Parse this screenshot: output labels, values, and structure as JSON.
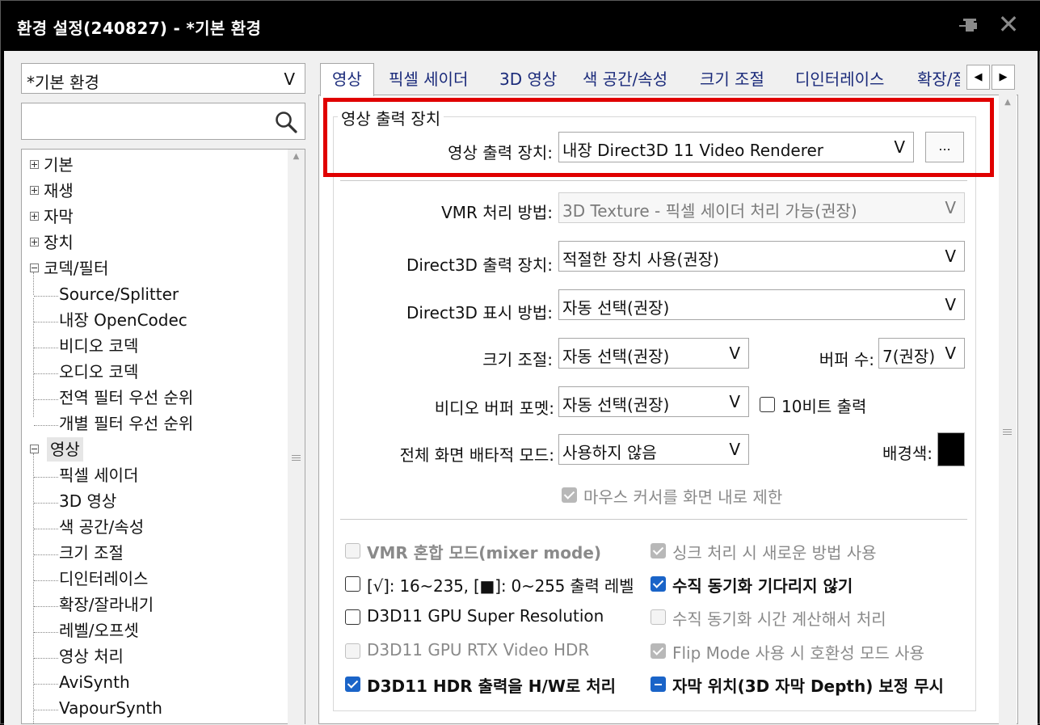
{
  "window": {
    "title": "환경 설정(240827) - *기본 환경",
    "close_glyph": "✕"
  },
  "profile": {
    "selected": "*기본 환경",
    "arrow": "V"
  },
  "search": {
    "value": ""
  },
  "tree": {
    "items": [
      {
        "label": "기본",
        "kind": "collapsed"
      },
      {
        "label": "재생",
        "kind": "collapsed"
      },
      {
        "label": "자막",
        "kind": "collapsed"
      },
      {
        "label": "장치",
        "kind": "collapsed"
      },
      {
        "label": "코덱/필터",
        "kind": "expanded"
      },
      {
        "label": "Source/Splitter",
        "kind": "child"
      },
      {
        "label": "내장 OpenCodec",
        "kind": "child"
      },
      {
        "label": "비디오 코덱",
        "kind": "child"
      },
      {
        "label": "오디오 코덱",
        "kind": "child"
      },
      {
        "label": "전역 필터 우선 순위",
        "kind": "child"
      },
      {
        "label": "개별 필터 우선 순위",
        "kind": "child"
      },
      {
        "label": "영상",
        "kind": "expanded-selected"
      },
      {
        "label": "픽셀 세이더",
        "kind": "child"
      },
      {
        "label": "3D 영상",
        "kind": "child"
      },
      {
        "label": "색 공간/속성",
        "kind": "child"
      },
      {
        "label": "크기 조절",
        "kind": "child"
      },
      {
        "label": "디인터레이스",
        "kind": "child"
      },
      {
        "label": "확장/잘라내기",
        "kind": "child"
      },
      {
        "label": "레벨/오프셋",
        "kind": "child"
      },
      {
        "label": "영상 처리",
        "kind": "child"
      },
      {
        "label": "AviSynth",
        "kind": "child"
      },
      {
        "label": "VapourSynth",
        "kind": "child"
      }
    ]
  },
  "tabs": [
    "영상",
    "픽셀 세이더",
    "3D 영상",
    "색 공간/속성",
    "크기 조절",
    "디인터레이스",
    "확장/잘"
  ],
  "tab_scroll": {
    "left": "◀",
    "right": "▶"
  },
  "group": {
    "title": "영상 출력 장치"
  },
  "fields": {
    "output_device": {
      "label": "영상 출력 장치:",
      "value": "내장 Direct3D 11 Video Renderer",
      "arrow": "V",
      "button": "..."
    },
    "vmr_method": {
      "label": "VMR 처리 방법:",
      "value": "3D Texture - 픽셀 세이더 처리 가능(권장)",
      "arrow": "V"
    },
    "d3d_device": {
      "label": "Direct3D 출력 장치:",
      "value": "적절한 장치 사용(권장)",
      "arrow": "V"
    },
    "d3d_display": {
      "label": "Direct3D 표시 방법:",
      "value": "자동 선택(권장)",
      "arrow": "V"
    },
    "resize": {
      "label": "크기 조절:",
      "value": "자동 선택(권장)",
      "arrow": "V"
    },
    "buffer_count": {
      "label": "버퍼 수:",
      "value": "7(권장)",
      "arrow": "V"
    },
    "buffer_format": {
      "label": "비디오 버퍼 포멧:",
      "value": "자동 선택(권장)",
      "arrow": "V"
    },
    "fullscreen_mode": {
      "label": "전체 화면 배타적 모드:",
      "value": "사용하지 않음",
      "arrow": "V"
    },
    "bg_color": {
      "label": "배경색:",
      "color": "#000000"
    }
  },
  "checkboxes": {
    "ten_bit": {
      "label": "10비트 출력",
      "checked": false
    },
    "cursor_limit": {
      "label": "마우스 커서를 화면 내로 제한",
      "checked": true,
      "enabled": false
    },
    "vmr_mixer": {
      "label": "VMR 혼합 모드(mixer mode)",
      "checked": false,
      "enabled": false
    },
    "level_range": {
      "label": "[√]: 16~235, [■]: 0~255 출력 레벨",
      "checked": false
    },
    "sync_new": {
      "label": "싱크 처리 시 새로운 방법 사용",
      "checked": true,
      "enabled": false
    },
    "no_vsync_wait": {
      "label": "수직 동기화 기다리지 않기",
      "checked": true
    },
    "super_res": {
      "label": "D3D11 GPU Super Resolution",
      "checked": false
    },
    "vsync_time": {
      "label": "수직 동기화 시간 계산해서 처리",
      "checked": false,
      "enabled": false
    },
    "rtx_hdr": {
      "label": "D3D11 GPU RTX Video HDR",
      "checked": false,
      "enabled": false
    },
    "flip_mode": {
      "label": "Flip Mode 사용 시 호환성 모드 사용",
      "checked": true,
      "enabled": false
    },
    "hdr_hw": {
      "label": "D3D11 HDR 출력을 H/W로 처리",
      "checked": true
    },
    "subtitle_depth": {
      "label": "자막 위치(3D 자막 Depth) 보정 무시",
      "state": "indeterminate"
    }
  },
  "colors": {
    "accent": "#1a64c8",
    "highlight": "#e00000",
    "title_bg": "#000000"
  }
}
